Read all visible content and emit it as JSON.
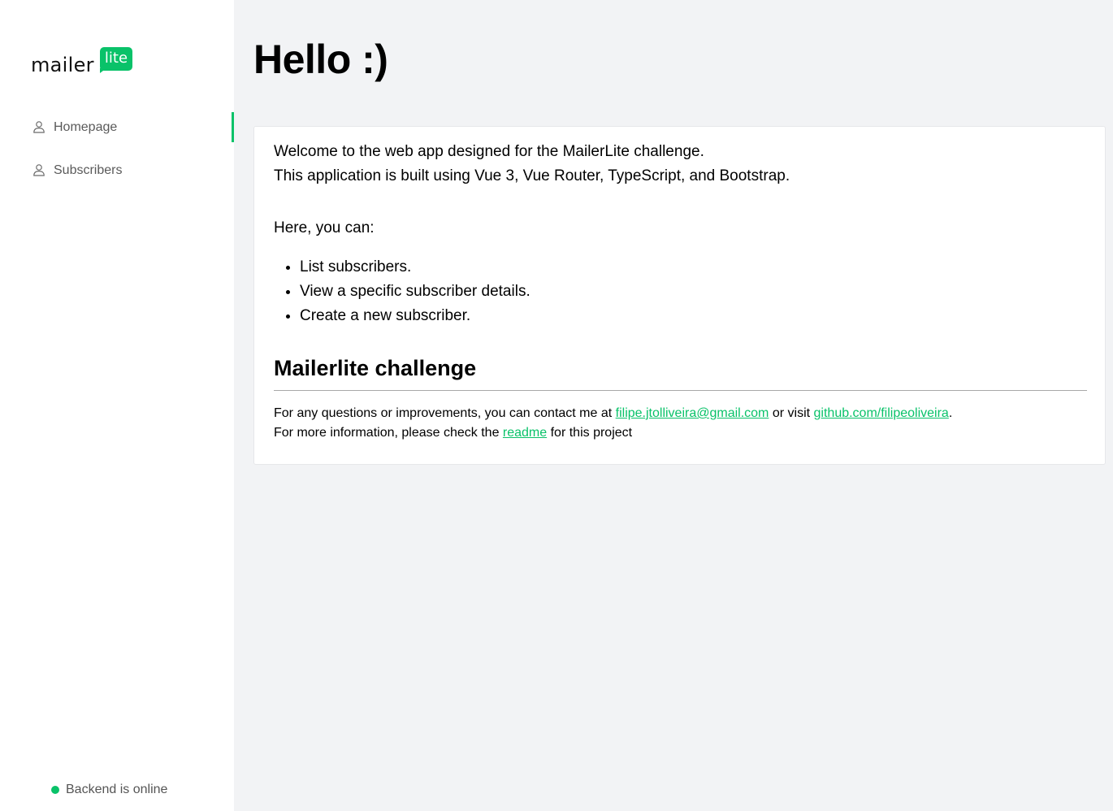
{
  "brand": {
    "word": "mailer",
    "badge": "lite",
    "accent_color": "#09c269"
  },
  "sidebar": {
    "items": [
      {
        "label": "Homepage",
        "icon": "user-icon",
        "active": true
      },
      {
        "label": "Subscribers",
        "icon": "user-icon",
        "active": false
      }
    ],
    "status": {
      "text": "Backend is online",
      "color": "#09c269"
    }
  },
  "main": {
    "title": "Hello :)",
    "card": {
      "intro_line1": "Welcome to the web app designed for the MailerLite challenge.",
      "intro_line2": "This application is built using Vue 3, Vue Router, TypeScript, and Bootstrap.",
      "here_label": "Here, you can:",
      "features": [
        "List subscribers.",
        "View a specific subscriber details.",
        "Create a new subscriber."
      ],
      "section_title": "Mailerlite challenge",
      "contact_prefix": "For any questions or improvements, you can contact me at ",
      "email_link": "filipe.jtolliveira@gmail.com",
      "contact_middle": " or visit ",
      "github_link": "github.com/filipeoliveira",
      "contact_suffix": ".",
      "readme_prefix": "For more information, please check the ",
      "readme_link": "readme",
      "readme_suffix": " for this project"
    }
  }
}
